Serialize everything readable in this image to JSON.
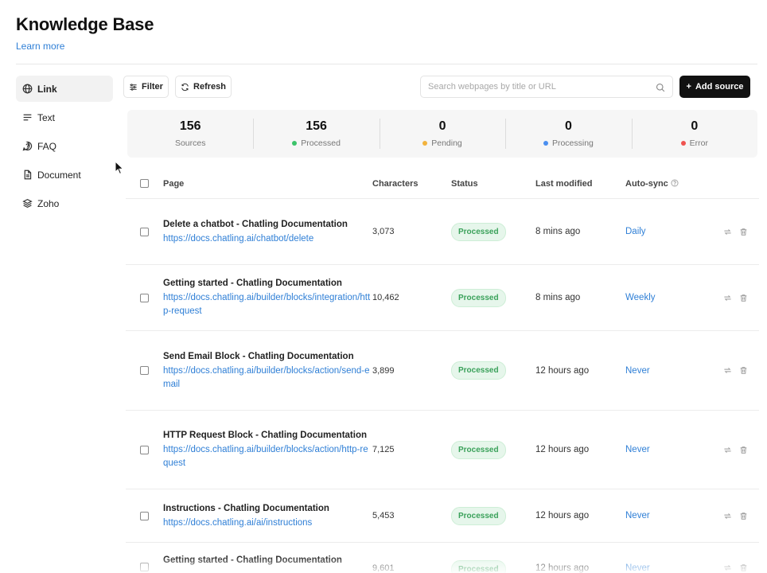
{
  "header": {
    "title": "Knowledge Base",
    "learn_more": "Learn more"
  },
  "sidebar": {
    "items": [
      {
        "label": "Link",
        "icon": "globe-icon",
        "active": true
      },
      {
        "label": "Text",
        "icon": "text-lines-icon",
        "active": false
      },
      {
        "label": "FAQ",
        "icon": "chat-question-icon",
        "active": false
      },
      {
        "label": "Document",
        "icon": "document-icon",
        "active": false
      },
      {
        "label": "Zoho",
        "icon": "layers-icon",
        "active": false
      }
    ]
  },
  "toolbar": {
    "filter_label": "Filter",
    "refresh_label": "Refresh",
    "search_placeholder": "Search webpages by title or URL",
    "add_label": "Add source",
    "add_prefix": "+"
  },
  "stats": [
    {
      "value": "156",
      "label": "Sources",
      "dot": null
    },
    {
      "value": "156",
      "label": "Processed",
      "dot": "#3cc36a"
    },
    {
      "value": "0",
      "label": "Pending",
      "dot": "#f2b33d"
    },
    {
      "value": "0",
      "label": "Processing",
      "dot": "#4a8ff0"
    },
    {
      "value": "0",
      "label": "Error",
      "dot": "#ef5350"
    }
  ],
  "table": {
    "headers": {
      "page": "Page",
      "characters": "Characters",
      "status": "Status",
      "last_modified": "Last modified",
      "auto_sync": "Auto-sync"
    },
    "rows": [
      {
        "title": "Delete a chatbot - Chatling Documentation",
        "url": "https://docs.chatling.ai/chatbot/delete",
        "characters": "3,073",
        "status": "Processed",
        "modified": "8 mins ago",
        "sync": "Daily"
      },
      {
        "title": "Getting started - Chatling Documentation",
        "url": "https://docs.chatling.ai/builder/blocks/integration/http-request",
        "characters": "10,462",
        "status": "Processed",
        "modified": "8 mins ago",
        "sync": "Weekly"
      },
      {
        "title": "Send Email Block - Chatling Documentation",
        "url": "https://docs.chatling.ai/builder/blocks/action/send-email",
        "characters": "3,899",
        "status": "Processed",
        "modified": "12 hours ago",
        "sync": "Never"
      },
      {
        "title": "HTTP Request Block - Chatling Documentation",
        "url": "https://docs.chatling.ai/builder/blocks/action/http-request",
        "characters": "7,125",
        "status": "Processed",
        "modified": "12 hours ago",
        "sync": "Never"
      },
      {
        "title": "Instructions - Chatling Documentation",
        "url": "https://docs.chatling.ai/ai/instructions",
        "characters": "5,453",
        "status": "Processed",
        "modified": "12 hours ago",
        "sync": "Never"
      },
      {
        "title": "Getting started - Chatling Documentation",
        "url": "",
        "characters": "9,601",
        "status": "Processed",
        "modified": "12 hours ago",
        "sync": "Never"
      }
    ]
  }
}
